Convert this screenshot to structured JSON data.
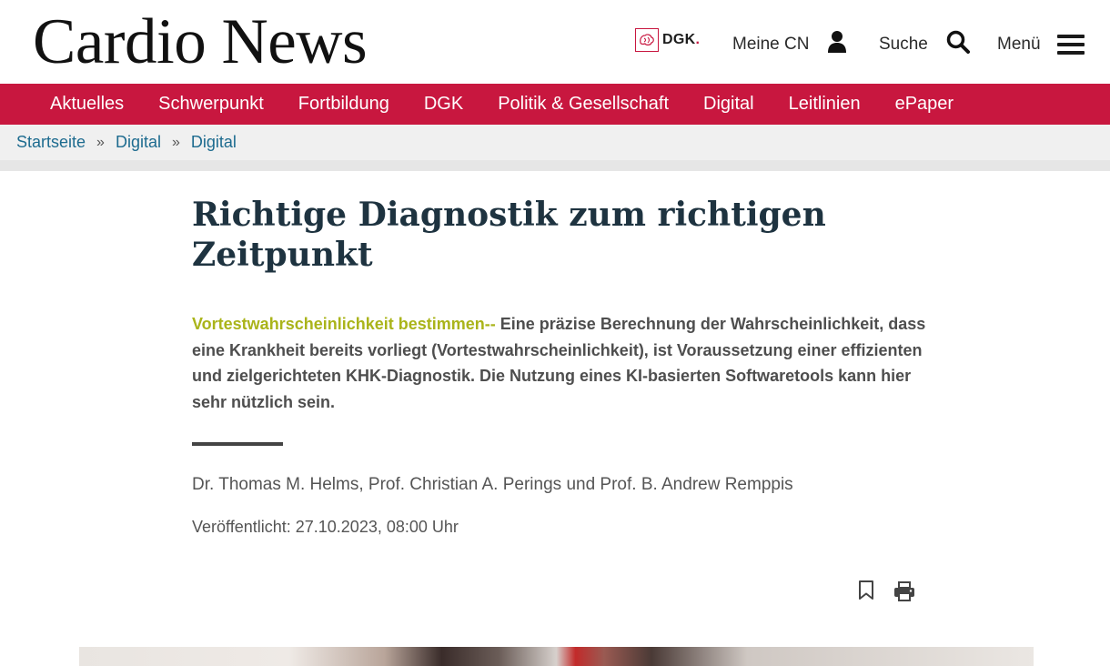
{
  "header": {
    "logo": "Cardio News",
    "dgk_label": "DGK",
    "dgk_dot": ".",
    "meine_cn": "Meine CN",
    "suche": "Suche",
    "menu": "Menü"
  },
  "nav": {
    "items": [
      "Aktuelles",
      "Schwerpunkt",
      "Fortbildung",
      "DGK",
      "Politik & Gesellschaft",
      "Digital",
      "Leitlinien",
      "ePaper"
    ]
  },
  "breadcrumb": {
    "items": [
      "Startseite",
      "Digital",
      "Digital"
    ],
    "separator": "»"
  },
  "article": {
    "title": "Richtige Diagnostik zum richtigen Zeitpunkt",
    "kicker": "Vortestwahrscheinlichkeit bestimmen--",
    "lead": " Eine präzise Berechnung der Wahrscheinlichkeit, dass eine Krankheit bereits vorliegt (Vortestwahrscheinlichkeit), ist Voraussetzung einer effizienten und zielgerichteten KHK-Diagnostik. Die Nutzung eines KI-basierten Softwaretools kann hier sehr nützlich sein.",
    "authors": "Dr. Thomas M. Helms, Prof. Christian A. Perings und Prof. B. Andrew Remppis",
    "published_label": "Veröffentlicht:",
    "published_value": "27.10.2023, 08:00 Uhr"
  },
  "colors": {
    "brand_red": "#c8173f",
    "kicker_green": "#aab41a",
    "link_blue": "#1d6b8f",
    "title_navy": "#1e3340"
  },
  "icons": [
    "user-icon",
    "search-icon",
    "hamburger-menu-icon",
    "bookmark-icon",
    "print-icon",
    "dgk-logo-icon"
  ]
}
